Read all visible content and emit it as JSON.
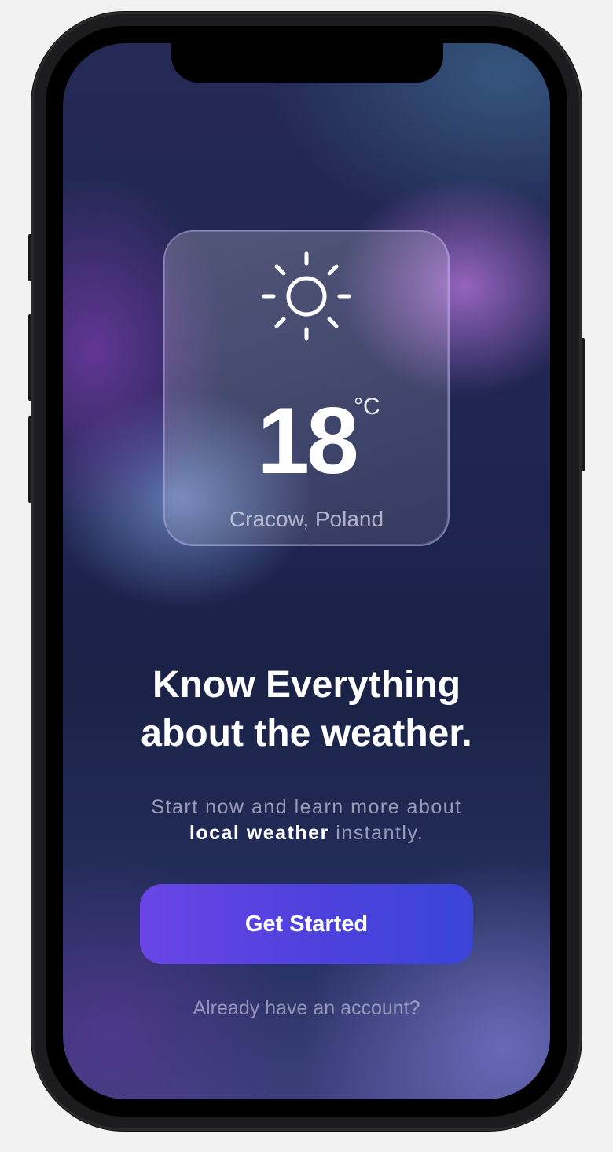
{
  "card": {
    "icon": "sun-icon",
    "temperature": "18",
    "unit": "°C",
    "location": "Cracow, Poland"
  },
  "onboarding": {
    "headline_line1": "Know Everything",
    "headline_line2": "about the weather.",
    "subtitle_part1": "Start now and learn more about",
    "subtitle_highlight": "local weather",
    "subtitle_part2": "instantly.",
    "cta_label": "Get Started",
    "login_label": "Already have an account?"
  },
  "colors": {
    "cta_start": "#6a45e6",
    "cta_end": "#3a45d8",
    "background": "#1e2450"
  }
}
